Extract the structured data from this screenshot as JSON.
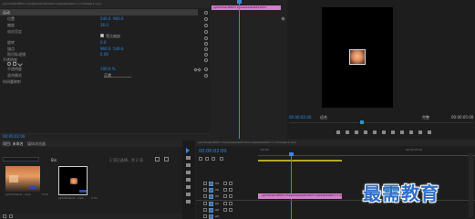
{
  "effect_controls": {
    "header_text": "ppt7b4a4c8f833 23a1b64a6da87e823 b0a4ab6ef8cf c1 d4d4a6b4 mp4",
    "properties": [
      {
        "label": "运动",
        "v1": "",
        "v2": ""
      },
      {
        "label": "位置",
        "v1": "540.0",
        "v2": "960.0"
      },
      {
        "label": "缩放",
        "v1": "36.0",
        "v2": ""
      },
      {
        "label": "缩放宽度",
        "v1": "",
        "v2": ""
      },
      {
        "label": "",
        "v1": "",
        "v2": "等比缩放"
      },
      {
        "label": "旋转",
        "v1": "0.0",
        "v2": ""
      },
      {
        "label": "锚点",
        "v1": "960.0",
        "v2": "540.0"
      },
      {
        "label": "防闪烁滤镜",
        "v1": "0.00",
        "v2": ""
      },
      {
        "label": "不透明度",
        "v1": "",
        "v2": ""
      },
      {
        "label": "",
        "v1": "",
        "v2": ""
      },
      {
        "label": "不透明度",
        "v1": "100.0 %",
        "v2": ""
      },
      {
        "label": "混合模式",
        "v1": "正常",
        "v2": ""
      },
      {
        "label": "时间重映射",
        "v1": "",
        "v2": ""
      }
    ],
    "scale_uniform_label": "等比缩放",
    "blend_mode_value": "正常",
    "timecode": "00:00:02:00"
  },
  "source_strip": {
    "clip_label": "ppt7b4a4c8f833 23a1b64a6da87e823"
  },
  "program_monitor": {
    "timecode_left": "00:00:02:00",
    "fit_label": "适合",
    "quality_label": "完整",
    "timecode_right": "00:00:05:00"
  },
  "project_panel": {
    "tab_project": "项目: 未命名",
    "tab_browser": "媒体浏览器",
    "search_placeholder": "",
    "count_text": "1 项已选择，共 2 项",
    "bin_label": "Bin",
    "items": [
      {
        "name": "ppt7b4a4c8...mp4",
        "duration": "5:00"
      },
      {
        "name": "ppt7b4a4c8...mp4",
        "duration": "5:00"
      }
    ]
  },
  "timeline": {
    "sequence_header": "ppt7b4a4c8f833 23a1b64a6da87e823 b0a4ab6ef8cf c1 d4d4a6b4 mp4",
    "timecode": "00:00:02:00",
    "ruler_start": ":00:00",
    "ruler_mid": "00:00:05:00",
    "clip_label": "ppt7b4a4c8f833 23a1b64a6da87e823 b0a4ab6ef8cf c1 d4d4a6b4 mp4",
    "tracks": [
      "V3",
      "V2",
      "V1",
      "A1",
      "A2",
      "A3"
    ]
  },
  "watermark": "最需教育",
  "colors": {
    "accent": "#2d8ceb",
    "clip_pink": "#d27ec9",
    "watermark": "#2f6fc7",
    "playhead": "#2d8ceb"
  }
}
